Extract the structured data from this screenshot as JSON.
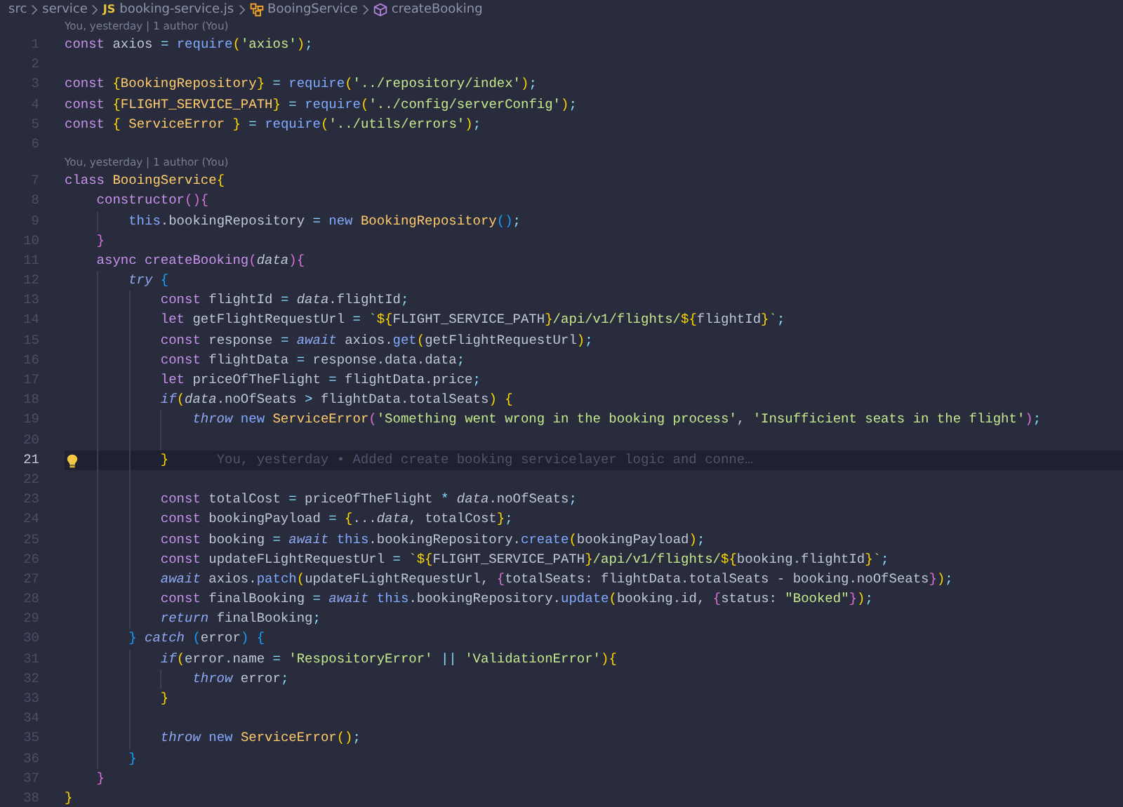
{
  "breadcrumb": [
    {
      "kind": "folder",
      "label": "src"
    },
    {
      "kind": "folder",
      "label": "service"
    },
    {
      "kind": "file",
      "badge": "JS",
      "label": "booking-service.js"
    },
    {
      "kind": "class",
      "label": "BooingService"
    },
    {
      "kind": "method",
      "label": "createBooking"
    }
  ],
  "lines": [
    {
      "n": "1",
      "current": false,
      "lens": "You, yesterday | 1 author (You)",
      "tokens": [
        {
          "kind": "keyword",
          "text": "const "
        },
        {
          "kind": "plain",
          "text": "axios "
        },
        {
          "kind": "operator",
          "text": "= "
        },
        {
          "kind": "function",
          "text": "require"
        },
        {
          "kind": "bracket1",
          "text": "("
        },
        {
          "kind": "string",
          "text": "'axios'"
        },
        {
          "kind": "bracket1",
          "text": ")"
        },
        {
          "kind": "operator",
          "text": ";"
        }
      ]
    },
    {
      "n": "2",
      "current": false
    },
    {
      "n": "3",
      "current": false,
      "tokens": [
        {
          "kind": "keyword",
          "text": "const "
        },
        {
          "kind": "bracket1",
          "text": "{"
        },
        {
          "kind": "type",
          "text": "BookingRepository"
        },
        {
          "kind": "bracket1",
          "text": "}"
        },
        {
          "kind": "operator",
          "text": " = "
        },
        {
          "kind": "function",
          "text": "require"
        },
        {
          "kind": "bracket1",
          "text": "("
        },
        {
          "kind": "string",
          "text": "'../repository/index'"
        },
        {
          "kind": "bracket1",
          "text": ")"
        },
        {
          "kind": "operator",
          "text": ";"
        }
      ]
    },
    {
      "n": "4",
      "current": false,
      "tokens": [
        {
          "kind": "keyword",
          "text": "const "
        },
        {
          "kind": "bracket1",
          "text": "{"
        },
        {
          "kind": "type",
          "text": "FLIGHT_SERVICE_PATH"
        },
        {
          "kind": "bracket1",
          "text": "}"
        },
        {
          "kind": "operator",
          "text": " = "
        },
        {
          "kind": "function",
          "text": "require"
        },
        {
          "kind": "bracket1",
          "text": "("
        },
        {
          "kind": "string",
          "text": "'../config/serverConfig'"
        },
        {
          "kind": "bracket1",
          "text": ")"
        },
        {
          "kind": "operator",
          "text": ";"
        }
      ]
    },
    {
      "n": "5",
      "current": false,
      "tokens": [
        {
          "kind": "keyword",
          "text": "const "
        },
        {
          "kind": "bracket1",
          "text": "{"
        },
        {
          "kind": "type",
          "text": " ServiceError "
        },
        {
          "kind": "bracket1",
          "text": "}"
        },
        {
          "kind": "operator",
          "text": " = "
        },
        {
          "kind": "function",
          "text": "require"
        },
        {
          "kind": "bracket1",
          "text": "("
        },
        {
          "kind": "string",
          "text": "'../utils/errors'"
        },
        {
          "kind": "bracket1",
          "text": ")"
        },
        {
          "kind": "operator",
          "text": ";"
        }
      ]
    },
    {
      "n": "6",
      "current": false
    },
    {
      "n": "7",
      "current": false,
      "lens": "You, yesterday | 1 author (You)",
      "tokens": [
        {
          "kind": "keyword",
          "text": "class "
        },
        {
          "kind": "type",
          "text": "BooingService"
        },
        {
          "kind": "bracket1",
          "text": "{"
        }
      ],
      "children": [
        {
          "n": "8",
          "current": false,
          "tokens": [
            {
              "kind": "keyword",
              "text": "constructor"
            },
            {
              "kind": "bracket2",
              "text": "(){"
            }
          ],
          "children": [
            {
              "n": "9",
              "current": false,
              "tokens": [
                {
                  "kind": "self",
                  "text": "this"
                },
                {
                  "kind": "plain",
                  "text": ".bookingRepository "
                },
                {
                  "kind": "operator",
                  "text": "= "
                },
                {
                  "kind": "self",
                  "text": "new "
                },
                {
                  "kind": "type",
                  "text": "BookingRepository"
                },
                {
                  "kind": "bracket3",
                  "text": "()"
                },
                {
                  "kind": "operator",
                  "text": ";"
                }
              ]
            }
          ]
        },
        {
          "n": "10",
          "current": false,
          "tokens": [
            {
              "kind": "bracket2",
              "text": "}"
            }
          ]
        },
        {
          "n": "11",
          "current": false,
          "tokens": [
            {
              "kind": "keyword",
              "text": "async createBooking"
            },
            {
              "kind": "bracket2",
              "text": "("
            },
            {
              "kind": "param",
              "text": "data"
            },
            {
              "kind": "bracket2",
              "text": "){"
            }
          ],
          "children": [
            {
              "n": "12",
              "current": false,
              "tokens": [
                {
                  "kind": "control",
                  "text": "try "
                },
                {
                  "kind": "bracket3",
                  "text": "{"
                }
              ],
              "children": [
                {
                  "n": "13",
                  "current": false,
                  "tokens": [
                    {
                      "kind": "keyword",
                      "text": "const "
                    },
                    {
                      "kind": "plain",
                      "text": "flightId "
                    },
                    {
                      "kind": "operator",
                      "text": "= "
                    },
                    {
                      "kind": "param",
                      "text": "data"
                    },
                    {
                      "kind": "plain",
                      "text": ".flightId"
                    },
                    {
                      "kind": "operator",
                      "text": ";"
                    }
                  ]
                },
                {
                  "n": "14",
                  "current": false,
                  "tokens": [
                    {
                      "kind": "keyword",
                      "text": "let "
                    },
                    {
                      "kind": "plain",
                      "text": "getFlightRequestUrl "
                    },
                    {
                      "kind": "operator",
                      "text": "= "
                    },
                    {
                      "kind": "string",
                      "text": "`"
                    },
                    {
                      "kind": "bracket1",
                      "text": "${"
                    },
                    {
                      "kind": "plain",
                      "text": "FLIGHT_SERVICE_PATH"
                    },
                    {
                      "kind": "bracket1",
                      "text": "}"
                    },
                    {
                      "kind": "string",
                      "text": "/api/v1/flights/"
                    },
                    {
                      "kind": "bracket1",
                      "text": "${"
                    },
                    {
                      "kind": "plain",
                      "text": "flightId"
                    },
                    {
                      "kind": "bracket1",
                      "text": "}"
                    },
                    {
                      "kind": "string",
                      "text": "`"
                    },
                    {
                      "kind": "operator",
                      "text": ";"
                    }
                  ]
                },
                {
                  "n": "15",
                  "current": false,
                  "tokens": [
                    {
                      "kind": "keyword",
                      "text": "const "
                    },
                    {
                      "kind": "plain",
                      "text": "response "
                    },
                    {
                      "kind": "operator",
                      "text": "= "
                    },
                    {
                      "kind": "control",
                      "text": "await "
                    },
                    {
                      "kind": "plain",
                      "text": "axios."
                    },
                    {
                      "kind": "function",
                      "text": "get"
                    },
                    {
                      "kind": "bracket1",
                      "text": "("
                    },
                    {
                      "kind": "plain",
                      "text": "getFlightRequestUrl"
                    },
                    {
                      "kind": "bracket1",
                      "text": ")"
                    },
                    {
                      "kind": "operator",
                      "text": ";"
                    }
                  ]
                },
                {
                  "n": "16",
                  "current": false,
                  "tokens": [
                    {
                      "kind": "keyword",
                      "text": "const "
                    },
                    {
                      "kind": "plain",
                      "text": "flightData "
                    },
                    {
                      "kind": "operator",
                      "text": "= "
                    },
                    {
                      "kind": "plain",
                      "text": "response.data.data"
                    },
                    {
                      "kind": "operator",
                      "text": ";"
                    }
                  ]
                },
                {
                  "n": "17",
                  "current": false,
                  "tokens": [
                    {
                      "kind": "keyword",
                      "text": "let "
                    },
                    {
                      "kind": "plain",
                      "text": "priceOfTheFlight "
                    },
                    {
                      "kind": "operator",
                      "text": "= "
                    },
                    {
                      "kind": "plain",
                      "text": "flightData.price"
                    },
                    {
                      "kind": "operator",
                      "text": ";"
                    }
                  ]
                },
                {
                  "n": "18",
                  "current": false,
                  "tokens": [
                    {
                      "kind": "control",
                      "text": "if"
                    },
                    {
                      "kind": "bracket1",
                      "text": "("
                    },
                    {
                      "kind": "param",
                      "text": "data"
                    },
                    {
                      "kind": "plain",
                      "text": ".noOfSeats "
                    },
                    {
                      "kind": "operator",
                      "text": "> "
                    },
                    {
                      "kind": "plain",
                      "text": "flightData.totalSeats"
                    },
                    {
                      "kind": "bracket1",
                      "text": ") {"
                    }
                  ],
                  "children": [
                    {
                      "n": "19",
                      "current": false,
                      "tokens": [
                        {
                          "kind": "control",
                          "text": "throw "
                        },
                        {
                          "kind": "self",
                          "text": "new "
                        },
                        {
                          "kind": "type",
                          "text": "ServiceError"
                        },
                        {
                          "kind": "bracket2",
                          "text": "("
                        },
                        {
                          "kind": "string",
                          "text": "'Something went wrong in the booking process'"
                        },
                        {
                          "kind": "plain",
                          "text": ", "
                        },
                        {
                          "kind": "string",
                          "text": "'Insufficient seats in the flight'"
                        },
                        {
                          "kind": "bracket2",
                          "text": ")"
                        },
                        {
                          "kind": "operator",
                          "text": ";"
                        }
                      ]
                    },
                    {
                      "n": "20",
                      "current": false
                    }
                  ]
                },
                {
                  "n": "21",
                  "current": true,
                  "blame": "You, yesterday • Added create booking servicelayer logic and conne…",
                  "tokens": [
                    {
                      "kind": "bracket1",
                      "text": "}"
                    }
                  ]
                },
                {
                  "n": "22",
                  "current": false
                },
                {
                  "n": "23",
                  "current": false,
                  "tokens": [
                    {
                      "kind": "keyword",
                      "text": "const "
                    },
                    {
                      "kind": "plain",
                      "text": "totalCost "
                    },
                    {
                      "kind": "operator",
                      "text": "= "
                    },
                    {
                      "kind": "plain",
                      "text": "priceOfTheFlight "
                    },
                    {
                      "kind": "operator",
                      "text": "* "
                    },
                    {
                      "kind": "param",
                      "text": "data"
                    },
                    {
                      "kind": "plain",
                      "text": ".noOfSeats"
                    },
                    {
                      "kind": "operator",
                      "text": ";"
                    }
                  ]
                },
                {
                  "n": "24",
                  "current": false,
                  "tokens": [
                    {
                      "kind": "keyword",
                      "text": "const "
                    },
                    {
                      "kind": "plain",
                      "text": "bookingPayload "
                    },
                    {
                      "kind": "operator",
                      "text": "= "
                    },
                    {
                      "kind": "bracket1",
                      "text": "{"
                    },
                    {
                      "kind": "plain",
                      "text": "..."
                    },
                    {
                      "kind": "param",
                      "text": "data"
                    },
                    {
                      "kind": "plain",
                      "text": ", totalCost"
                    },
                    {
                      "kind": "bracket1",
                      "text": "}"
                    },
                    {
                      "kind": "operator",
                      "text": ";"
                    }
                  ]
                },
                {
                  "n": "25",
                  "current": false,
                  "tokens": [
                    {
                      "kind": "keyword",
                      "text": "const "
                    },
                    {
                      "kind": "plain",
                      "text": "booking "
                    },
                    {
                      "kind": "operator",
                      "text": "= "
                    },
                    {
                      "kind": "control",
                      "text": "await "
                    },
                    {
                      "kind": "self",
                      "text": "this"
                    },
                    {
                      "kind": "plain",
                      "text": ".bookingRepository."
                    },
                    {
                      "kind": "function",
                      "text": "create"
                    },
                    {
                      "kind": "bracket1",
                      "text": "("
                    },
                    {
                      "kind": "plain",
                      "text": "bookingPayload"
                    },
                    {
                      "kind": "bracket1",
                      "text": ")"
                    },
                    {
                      "kind": "operator",
                      "text": ";"
                    }
                  ]
                },
                {
                  "n": "26",
                  "current": false,
                  "tokens": [
                    {
                      "kind": "keyword",
                      "text": "const "
                    },
                    {
                      "kind": "plain",
                      "text": "updateFLightRequestUrl "
                    },
                    {
                      "kind": "operator",
                      "text": "= "
                    },
                    {
                      "kind": "string",
                      "text": "`"
                    },
                    {
                      "kind": "bracket1",
                      "text": "${"
                    },
                    {
                      "kind": "plain",
                      "text": "FLIGHT_SERVICE_PATH"
                    },
                    {
                      "kind": "bracket1",
                      "text": "}"
                    },
                    {
                      "kind": "string",
                      "text": "/api/v1/flights/"
                    },
                    {
                      "kind": "bracket1",
                      "text": "${"
                    },
                    {
                      "kind": "plain",
                      "text": "booking.flightId"
                    },
                    {
                      "kind": "bracket1",
                      "text": "}"
                    },
                    {
                      "kind": "string",
                      "text": "`"
                    },
                    {
                      "kind": "operator",
                      "text": ";"
                    }
                  ]
                },
                {
                  "n": "27",
                  "current": false,
                  "tokens": [
                    {
                      "kind": "control",
                      "text": "await "
                    },
                    {
                      "kind": "plain",
                      "text": "axios."
                    },
                    {
                      "kind": "function",
                      "text": "patch"
                    },
                    {
                      "kind": "bracket1",
                      "text": "("
                    },
                    {
                      "kind": "plain",
                      "text": "updateFLightRequestUrl, "
                    },
                    {
                      "kind": "bracket2",
                      "text": "{"
                    },
                    {
                      "kind": "plain",
                      "text": "totalSeats: flightData.totalSeats - booking.noOfSeats"
                    },
                    {
                      "kind": "bracket2",
                      "text": "}"
                    },
                    {
                      "kind": "bracket1",
                      "text": ")"
                    },
                    {
                      "kind": "operator",
                      "text": ";"
                    }
                  ]
                },
                {
                  "n": "28",
                  "current": false,
                  "tokens": [
                    {
                      "kind": "keyword",
                      "text": "const "
                    },
                    {
                      "kind": "plain",
                      "text": "finalBooking "
                    },
                    {
                      "kind": "operator",
                      "text": "= "
                    },
                    {
                      "kind": "control",
                      "text": "await "
                    },
                    {
                      "kind": "self",
                      "text": "this"
                    },
                    {
                      "kind": "plain",
                      "text": ".bookingRepository."
                    },
                    {
                      "kind": "function",
                      "text": "update"
                    },
                    {
                      "kind": "bracket1",
                      "text": "("
                    },
                    {
                      "kind": "plain",
                      "text": "booking.id, "
                    },
                    {
                      "kind": "bracket2",
                      "text": "{"
                    },
                    {
                      "kind": "plain",
                      "text": "status: "
                    },
                    {
                      "kind": "string",
                      "text": "\"Booked\""
                    },
                    {
                      "kind": "bracket2",
                      "text": "}"
                    },
                    {
                      "kind": "bracket1",
                      "text": ")"
                    },
                    {
                      "kind": "operator",
                      "text": ";"
                    }
                  ]
                },
                {
                  "n": "29",
                  "current": false,
                  "tokens": [
                    {
                      "kind": "control",
                      "text": "return "
                    },
                    {
                      "kind": "plain",
                      "text": "finalBooking"
                    },
                    {
                      "kind": "operator",
                      "text": ";"
                    }
                  ]
                }
              ]
            },
            {
              "n": "30",
              "current": false,
              "tokens": [
                {
                  "kind": "bracket3",
                  "text": "} "
                },
                {
                  "kind": "control",
                  "text": "catch "
                },
                {
                  "kind": "bracket3",
                  "text": "("
                },
                {
                  "kind": "plain",
                  "text": "error"
                },
                {
                  "kind": "bracket3",
                  "text": ") {"
                }
              ],
              "children": [
                {
                  "n": "31",
                  "current": false,
                  "tokens": [
                    {
                      "kind": "control",
                      "text": "if"
                    },
                    {
                      "kind": "bracket1",
                      "text": "("
                    },
                    {
                      "kind": "plain",
                      "text": "error.name "
                    },
                    {
                      "kind": "operator",
                      "text": "= "
                    },
                    {
                      "kind": "string",
                      "text": "'RespositoryError'"
                    },
                    {
                      "kind": "operator",
                      "text": " || "
                    },
                    {
                      "kind": "string",
                      "text": "'ValidationError'"
                    },
                    {
                      "kind": "bracket1",
                      "text": "){"
                    }
                  ],
                  "children": [
                    {
                      "n": "32",
                      "current": false,
                      "tokens": [
                        {
                          "kind": "control",
                          "text": "throw "
                        },
                        {
                          "kind": "plain",
                          "text": "error"
                        },
                        {
                          "kind": "operator",
                          "text": ";"
                        }
                      ]
                    }
                  ]
                },
                {
                  "n": "33",
                  "current": false,
                  "tokens": [
                    {
                      "kind": "bracket1",
                      "text": "}"
                    }
                  ]
                },
                {
                  "n": "34",
                  "current": false
                },
                {
                  "n": "35",
                  "current": false,
                  "tokens": [
                    {
                      "kind": "control",
                      "text": "throw "
                    },
                    {
                      "kind": "self",
                      "text": "new "
                    },
                    {
                      "kind": "type",
                      "text": "ServiceError"
                    },
                    {
                      "kind": "bracket1",
                      "text": "()"
                    },
                    {
                      "kind": "operator",
                      "text": ";"
                    }
                  ]
                }
              ]
            },
            {
              "n": "36",
              "current": false,
              "tokens": [
                {
                  "kind": "bracket3",
                  "text": "}"
                }
              ]
            }
          ]
        },
        {
          "n": "37",
          "current": false,
          "tokens": [
            {
              "kind": "bracket2",
              "text": "}"
            }
          ]
        }
      ]
    },
    {
      "n": "38",
      "current": false,
      "tokens": [
        {
          "kind": "bracket1",
          "text": "}"
        }
      ]
    }
  ]
}
